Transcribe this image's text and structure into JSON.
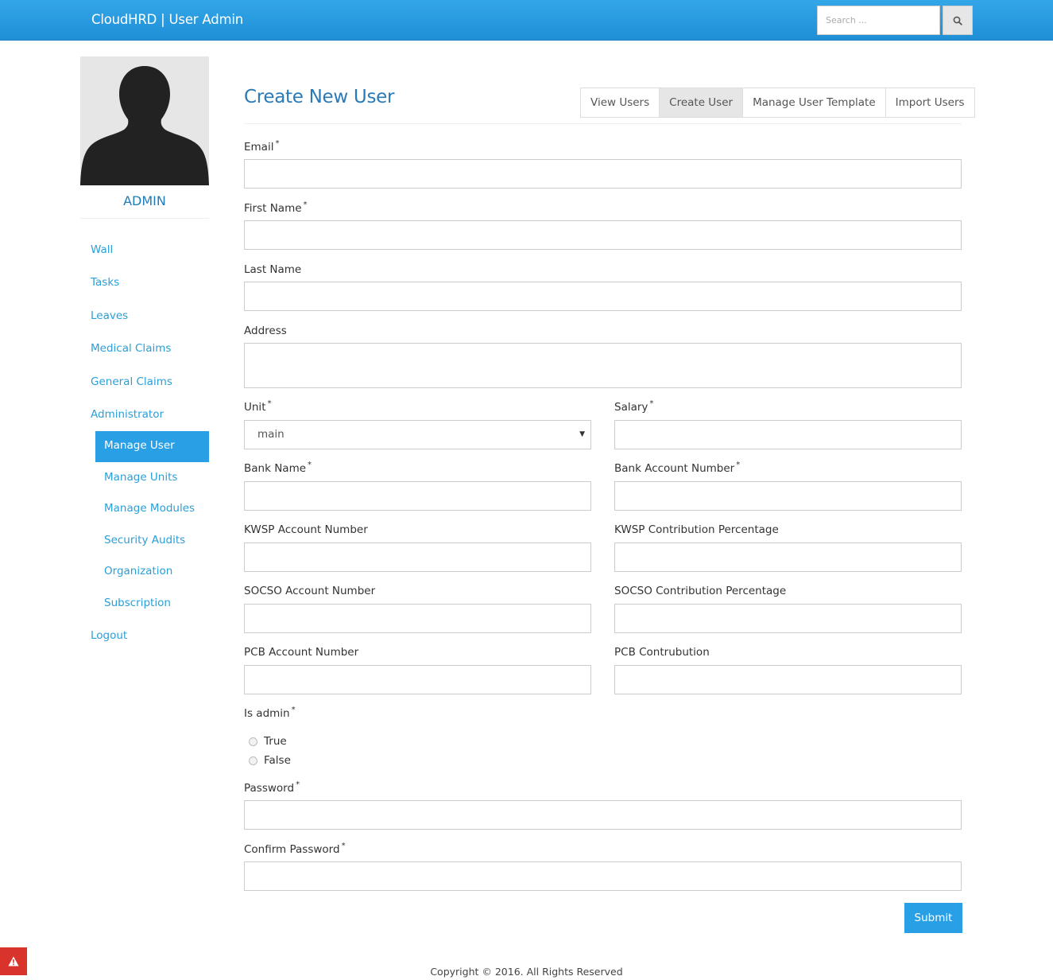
{
  "navbar": {
    "brand": "CloudHRD | User Admin",
    "search_placeholder": "Search ...",
    "search_icon": "search-icon",
    "color": "#2a9de2"
  },
  "sidebar": {
    "avatar_icon": "user-silhouette-icon",
    "user_name": "ADMIN",
    "items": [
      {
        "label": "Wall"
      },
      {
        "label": "Tasks"
      },
      {
        "label": "Leaves"
      },
      {
        "label": "Medical Claims"
      },
      {
        "label": "General Claims"
      },
      {
        "label": "Administrator"
      }
    ],
    "subitems": [
      {
        "label": "Manage User",
        "active": true
      },
      {
        "label": "Manage Units"
      },
      {
        "label": "Manage Modules"
      },
      {
        "label": "Security Audits"
      },
      {
        "label": "Organization"
      },
      {
        "label": "Subscription"
      }
    ],
    "logout": "Logout",
    "accent": "#29a0e6"
  },
  "main": {
    "title": "Create New User",
    "tabs": [
      {
        "label": "View Users"
      },
      {
        "label": "Create User",
        "active": true
      },
      {
        "label": "Manage User Template"
      },
      {
        "label": "Import Users"
      }
    ],
    "form": {
      "email": {
        "label": "Email",
        "value": ""
      },
      "first_name": {
        "label": "First Name",
        "value": ""
      },
      "last_name": {
        "label": "Last Name",
        "value": ""
      },
      "address": {
        "label": "Address",
        "value": ""
      },
      "unit": {
        "label": "Unit",
        "selected": "main"
      },
      "salary": {
        "label": "Salary",
        "value": ""
      },
      "bank_name": {
        "label": "Bank Name",
        "value": ""
      },
      "bank_account": {
        "label": "Bank Account Number",
        "value": ""
      },
      "kwsp_account": {
        "label": "KWSP Account Number",
        "value": ""
      },
      "kwsp_pct": {
        "label": "KWSP Contribution Percentage",
        "value": ""
      },
      "socso_account": {
        "label": "SOCSO Account Number",
        "value": ""
      },
      "socso_pct": {
        "label": "SOCSO Contribution Percentage",
        "value": ""
      },
      "pcb_account": {
        "label": "PCB Account Number",
        "value": ""
      },
      "pcb_contribution": {
        "label": "PCB Contrubution",
        "value": ""
      },
      "is_admin": {
        "label": "Is admin",
        "options": [
          "True",
          "False"
        ]
      },
      "password": {
        "label": "Password",
        "value": ""
      },
      "confirm_password": {
        "label": "Confirm Password",
        "value": ""
      },
      "required_mark": "*",
      "submit": "Submit"
    }
  },
  "alert_icon": "warning-icon",
  "footer": "Copyright © 2016. All Rights Reserved"
}
